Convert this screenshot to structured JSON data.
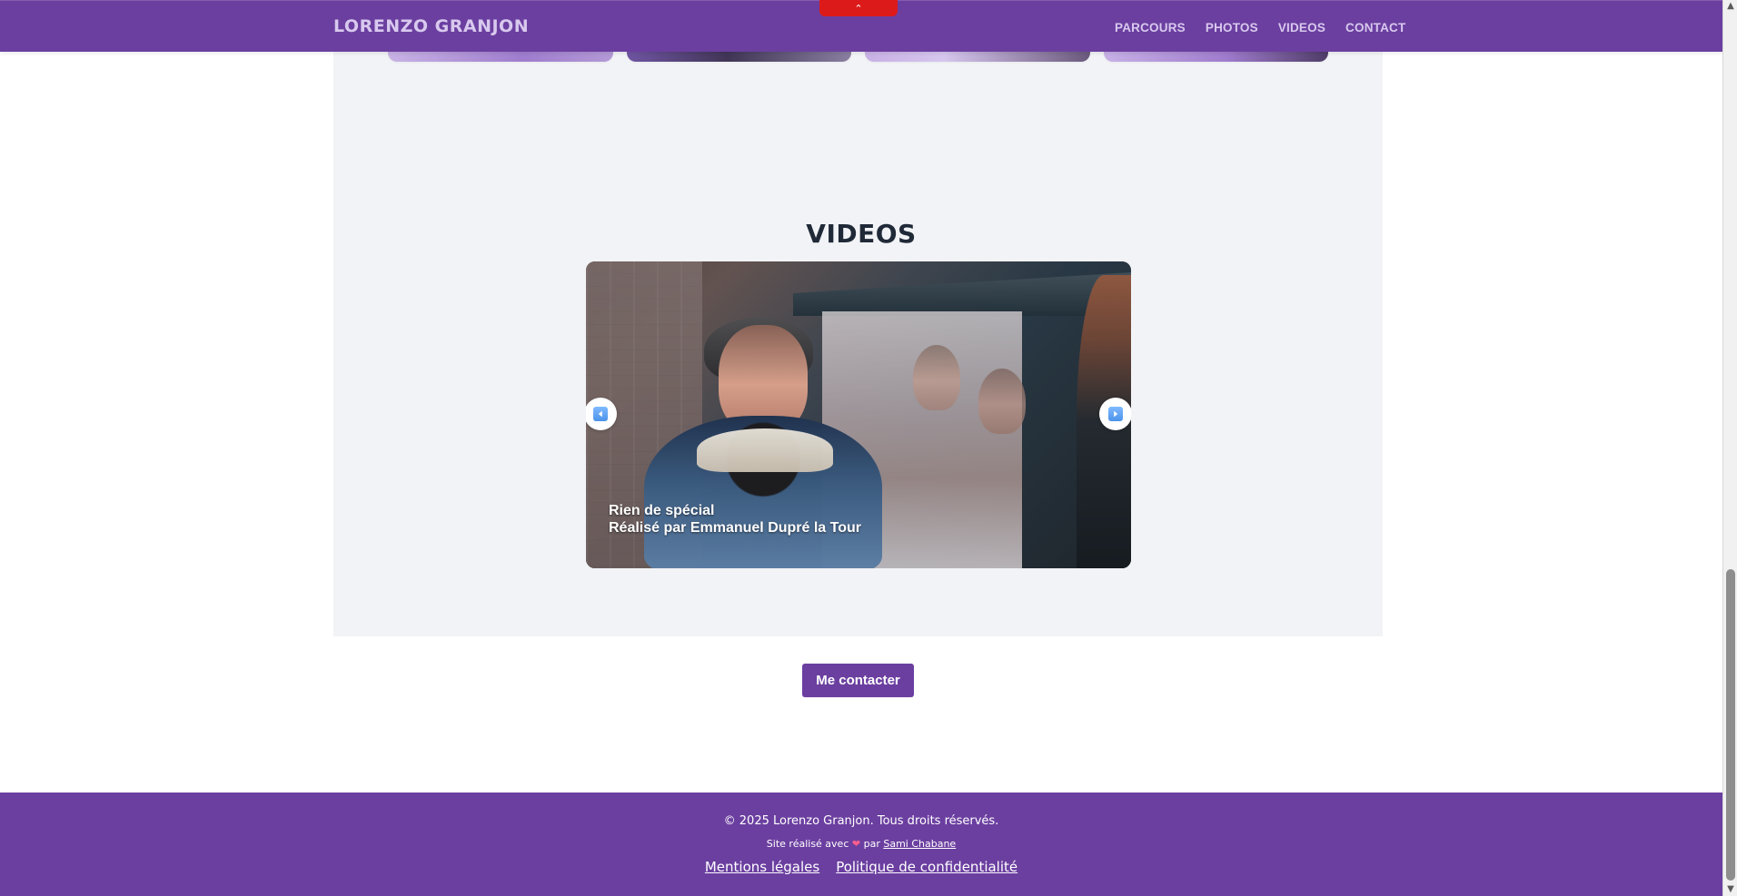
{
  "window": {
    "title": ""
  },
  "header": {
    "brand": "LORENZO GRANJON",
    "nav": [
      {
        "label": "PARCOURS"
      },
      {
        "label": "PHOTOS"
      },
      {
        "label": "VIDEOS"
      },
      {
        "label": "CONTACT"
      }
    ],
    "top_button_icon": "chevron-up-icon"
  },
  "section": {
    "title": "VIDEOS"
  },
  "video": {
    "overlay_title": "Rien de spécial",
    "overlay_credit": "Réalisé par Emmanuel Dupré la Tour",
    "prev_icon": "chevron-left-icon",
    "next_icon": "chevron-right-icon"
  },
  "cta": {
    "label": "Me contacter"
  },
  "footer": {
    "copyright": "© 2025 Lorenzo Granjon. Tous droits réservés.",
    "made_with_prefix": "Site réalisé avec",
    "heart": "❤",
    "made_with_middle": "par",
    "author": "Sami Chabane",
    "links": [
      {
        "label": "Mentions légales"
      },
      {
        "label": "Politique de confidentialité"
      }
    ]
  },
  "scrollbar": {
    "up_icon": "chevron-up-icon",
    "down_icon": "chevron-down-icon"
  },
  "colors": {
    "brand": "#6b3fa0",
    "page_bg": "#ffffff",
    "section_bg": "#f2f3f6",
    "accent_red": "#dd1a1a",
    "text_dark": "#1f2937",
    "text_light": "#ffffff"
  }
}
